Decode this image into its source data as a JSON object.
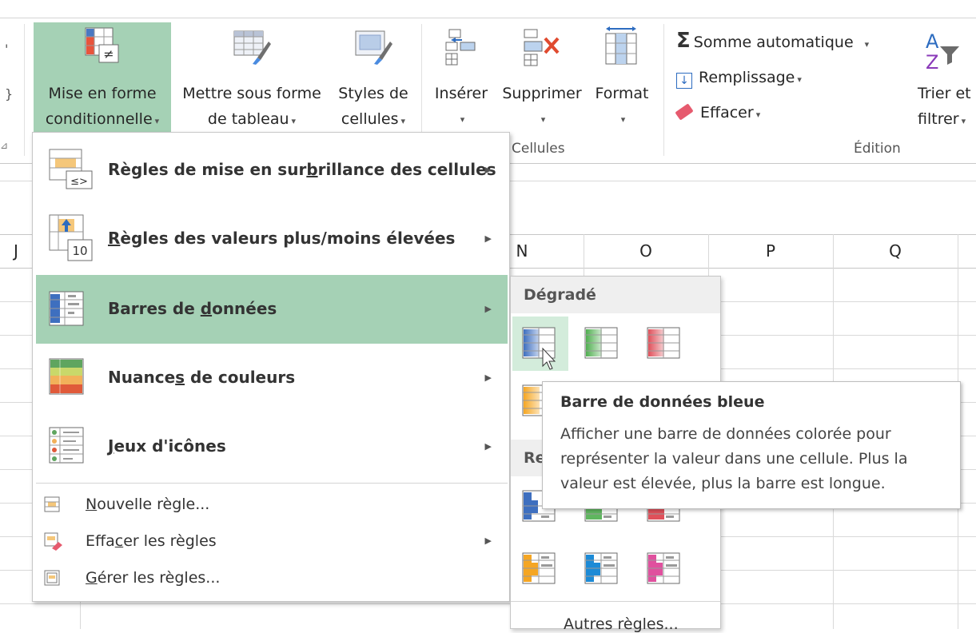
{
  "ribbon": {
    "styles_group": {
      "conditional_formatting": {
        "line1": "Mise en forme",
        "line2": "conditionnelle"
      },
      "format_as_table": {
        "line1": "Mettre sous forme",
        "line2": "de tableau"
      },
      "cell_styles": {
        "line1": "Styles de",
        "line2": "cellules"
      }
    },
    "cells_group": {
      "label": "Cellules",
      "insert": "Insérer",
      "delete": "Supprimer",
      "format": "Format"
    },
    "editing_group": {
      "label": "Édition",
      "autosum": "Somme automatique",
      "fill": "Remplissage",
      "clear": "Effacer",
      "sort_filter": {
        "line1": "Trier et",
        "line2": "filtrer"
      }
    },
    "partial_left": {
      "top": "'",
      "mid": "}"
    }
  },
  "columns": [
    "J",
    "N",
    "O",
    "P",
    "Q"
  ],
  "cf_menu": {
    "highlight_rules": {
      "pre": "Règles de mise en sur",
      "u": "b",
      "post": "rillance des cellules"
    },
    "top_bottom_rules": {
      "pre": "",
      "u": "R",
      "post": "ègles des valeurs plus/moins élevées"
    },
    "data_bars": {
      "pre": "Barres de ",
      "u": "d",
      "post": "onnées"
    },
    "color_scales": {
      "pre": "Nuance",
      "u": "s",
      "post": " de couleurs"
    },
    "icon_sets": {
      "pre": "",
      "u": "J",
      "post": "eux d'icônes"
    },
    "new_rule": {
      "pre": "",
      "u": "N",
      "post": "ouvelle règle..."
    },
    "clear_rules": {
      "pre": "Effa",
      "u": "c",
      "post": "er les règles"
    },
    "manage_rules": {
      "pre": "",
      "u": "G",
      "post": "érer les règles..."
    },
    "icon_badge_highlight": "≤>",
    "icon_badge_topbottom": "10"
  },
  "databar_submenu": {
    "gradient_header": "Dégradé",
    "solid_header_partial": "Re",
    "more_rules": "Autres règles..."
  },
  "tooltip": {
    "title": "Barre de données bleue",
    "body": "Afficher une barre de données colorée pour représenter la valeur dans une cellule. Plus la valeur est élevée, plus la barre est longue."
  },
  "colors": {
    "highlight_green": "#a5d1b5",
    "bar_blue": "#3e6fbf",
    "bar_green": "#5fb65f",
    "bar_red": "#e0505a",
    "bar_orange": "#f5a623",
    "bar_lightblue": "#1c8ad6",
    "bar_pink": "#e0509e"
  }
}
